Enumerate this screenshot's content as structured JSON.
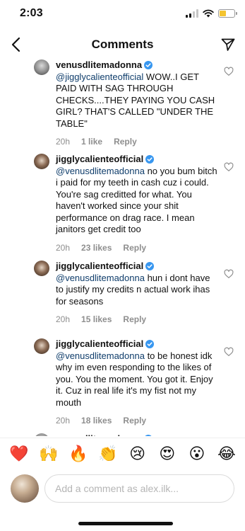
{
  "status": {
    "time": "2:03",
    "battery_level": 0.45
  },
  "nav": {
    "title": "Comments"
  },
  "comments": [
    {
      "username": "venusdlitemadonna",
      "mention": "@jigglycalienteofficial",
      "text": " WOW..I GET PAID WITH SAG THROUGH CHECKS....THEY PAYING YOU CASH GIRL? THAT'S CALLED \"UNDER THE TABLE\"",
      "time": "20h",
      "likes": "1 like",
      "reply": "Reply"
    },
    {
      "username": "jigglycalienteofficial",
      "mention": "@venusdlitemadonna",
      "text": " no you bum bitch i paid for my teeth in cash cuz i could. You're sag creditted for what.  You haven't worked since your shit  performance on drag race.  I mean janitors get credit too",
      "time": "20h",
      "likes": "23 likes",
      "reply": "Reply"
    },
    {
      "username": "jigglycalienteofficial",
      "mention": "@venusdlitemadonna",
      "text": " hun i dont have to justify my credits n actual work ihas for seasons",
      "time": "20h",
      "likes": "15 likes",
      "reply": "Reply"
    },
    {
      "username": "jigglycalienteofficial",
      "mention": "@venusdlitemadonna",
      "text": " to be honest idk why im even responding to the likes of you.  You the moment.  You got it. Enjoy it. Cuz in real life it's my fist not my mouth",
      "time": "20h",
      "likes": "18 likes",
      "reply": "Reply"
    },
    {
      "username": "venusdlitemadonna"
    }
  ],
  "emoji_bar": [
    "❤️",
    "🙌",
    "🔥",
    "👏",
    "😢",
    "😍",
    "😮",
    "😂"
  ],
  "composer": {
    "placeholder": "Add a comment as alex.ilk..."
  },
  "colors": {
    "verified": "#3897f0",
    "mention": "#0f3d6b",
    "muted": "#8e8e8e"
  }
}
